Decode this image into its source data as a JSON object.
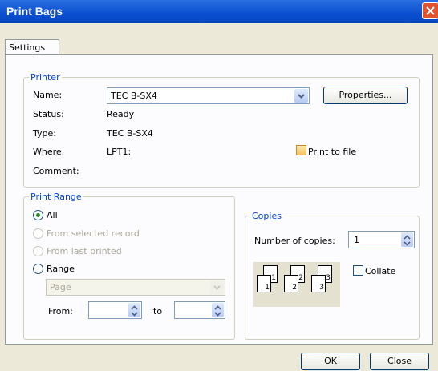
{
  "window": {
    "title": "Print Bags",
    "tab": "Settings"
  },
  "printer": {
    "group_label": "Printer",
    "name_label": "Name:",
    "name_value": "TEC B-SX4",
    "status_label": "Status:",
    "status_value": "Ready",
    "type_label": "Type:",
    "type_value": "TEC B-SX4",
    "where_label": "Where:",
    "where_value": "LPT1:",
    "comment_label": "Comment:",
    "properties_button": "Properties...",
    "print_to_file": "Print to file"
  },
  "print_range": {
    "group_label": "Print Range",
    "all": "All",
    "from_selected": "From selected record",
    "from_last": "From last printed",
    "range": "Range",
    "range_select": "Page",
    "from_label": "From:",
    "from_value": "",
    "to_label": "to",
    "to_value": ""
  },
  "copies": {
    "group_label": "Copies",
    "number_label": "Number of copies:",
    "number_value": "1",
    "collate": "Collate",
    "pages": [
      "1",
      "1",
      "2",
      "2",
      "3",
      "3"
    ]
  },
  "buttons": {
    "ok": "OK",
    "close": "Close"
  },
  "colors": {
    "titlebar": "#0a4fd0",
    "group_label": "#0046d5",
    "close_button": "#e0532f"
  }
}
